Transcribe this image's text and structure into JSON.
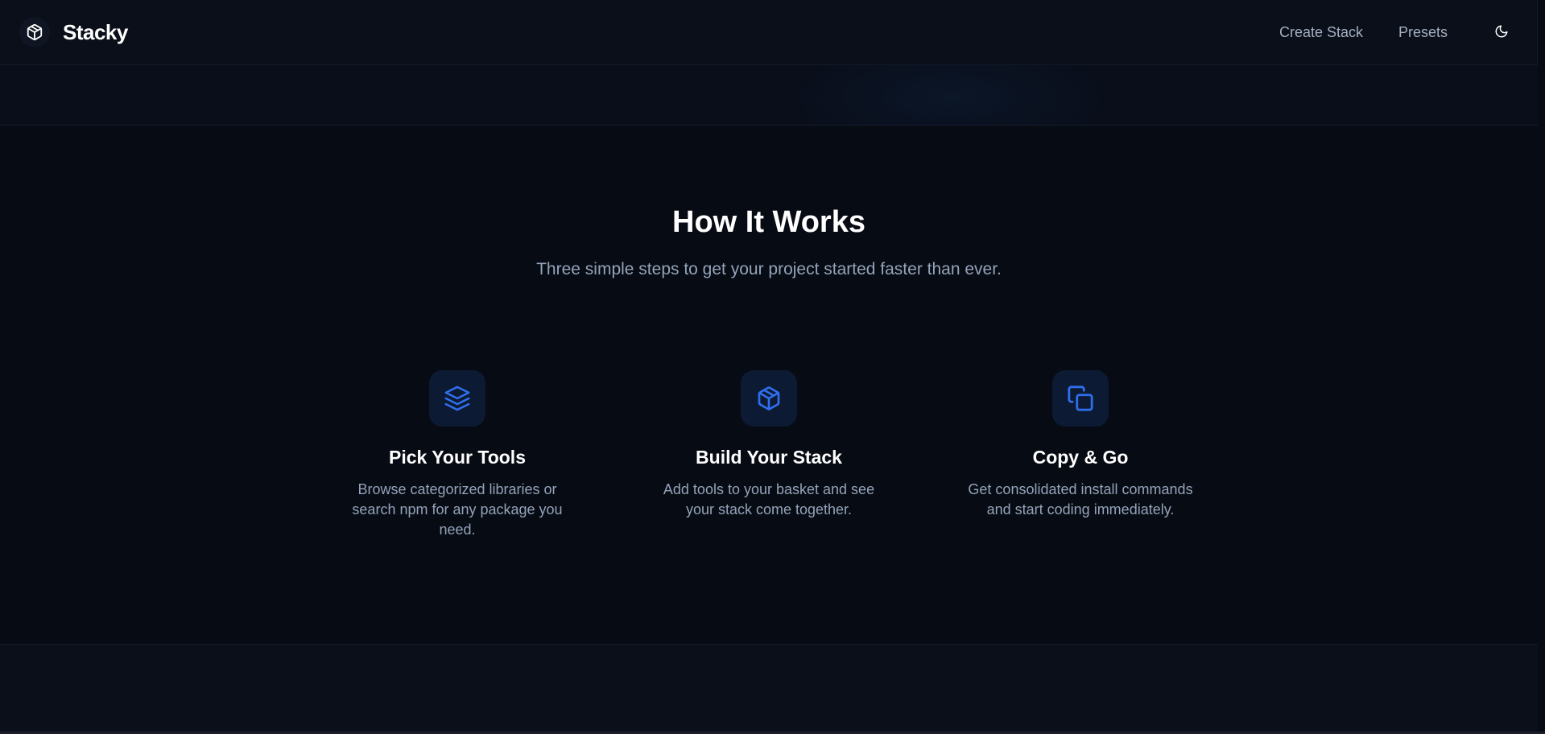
{
  "header": {
    "app_name": "Stacky",
    "logo_icon": "package-icon",
    "nav": [
      {
        "label": "Create Stack"
      },
      {
        "label": "Presets"
      }
    ],
    "theme_toggle_icon": "moon-icon"
  },
  "how_it_works": {
    "title": "How It Works",
    "subtitle": "Three simple steps to get your project started faster than ever.",
    "steps": [
      {
        "icon": "layers-icon",
        "title": "Pick Your Tools",
        "description": "Browse categorized libraries or search npm for any package you need."
      },
      {
        "icon": "package-icon",
        "title": "Build Your Stack",
        "description": "Add tools to your basket and see your stack come together."
      },
      {
        "icon": "copy-icon",
        "title": "Copy & Go",
        "description": "Get consolidated install commands and start coding immediately."
      }
    ]
  },
  "colors": {
    "background": "#070b14",
    "accent": "#2f6fed",
    "muted_text": "#94a3b8"
  }
}
